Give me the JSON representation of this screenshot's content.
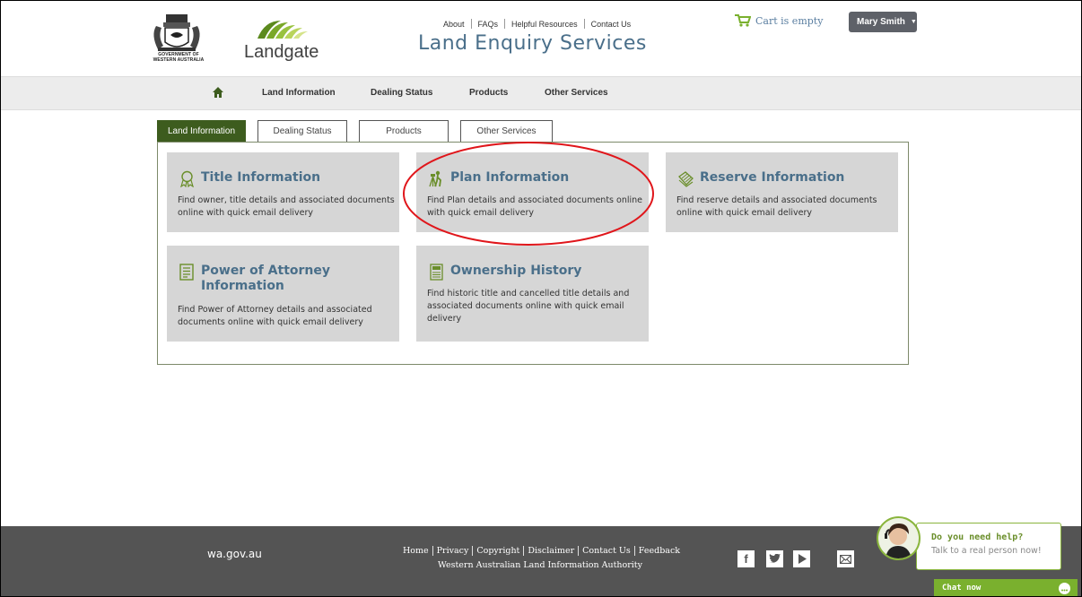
{
  "header": {
    "gov_logo_text": "GOVERNMENT OF\nWESTERN AUSTRALIA",
    "brand_name": "Landgate",
    "top_links": [
      "About",
      "FAQs",
      "Helpful Resources",
      "Contact Us"
    ],
    "site_title": "Land Enquiry Services",
    "cart_text": "Cart is empty",
    "user_name": "Mary Smith"
  },
  "navbar": {
    "home_icon": "home-icon",
    "items": [
      "Land Information",
      "Dealing Status",
      "Products",
      "Other Services"
    ]
  },
  "tabs": [
    "Land Information",
    "Dealing Status",
    "Products",
    "Other Services"
  ],
  "active_tab": "Land Information",
  "cards": [
    {
      "title": "Title Information",
      "icon": "ribbon-icon",
      "description": [
        "Find owner, title details and associated documents",
        "online with quick email delivery"
      ]
    },
    {
      "title": "Plan Information",
      "icon": "surveyor-icon",
      "description": [
        "Find Plan details and associated documents online",
        "with quick email delivery"
      ]
    },
    {
      "title": "Reserve Information",
      "icon": "map-icon",
      "description": [
        "Find reserve details and associated documents",
        "online with quick email delivery"
      ]
    },
    {
      "title_lines": [
        "Power of Attorney",
        "Information"
      ],
      "icon": "document-list-icon",
      "description": [
        "Find Power of Attorney details and associated",
        "documents online with quick email delivery"
      ]
    },
    {
      "title": "Ownership History",
      "icon": "archive-icon",
      "description": [
        "Find historic title and cancelled title details and",
        "associated documents online with quick email",
        "delivery"
      ]
    }
  ],
  "footer": {
    "wa_gov": "wa.gov.au",
    "links": [
      "Home",
      "Privacy",
      "Copyright",
      "Disclaimer",
      "Contact Us",
      "Feedback"
    ],
    "authority": "Western Australian Land Information Authority",
    "social": [
      "facebook-icon",
      "twitter-icon",
      "youtube-icon",
      "email-icon"
    ]
  },
  "chat": {
    "title": "Do you need help?",
    "subtitle": "Talk to a real person now!",
    "bar_label": "Chat now"
  },
  "colors": {
    "accent_green": "#3d5c1e",
    "title_blue": "#4a6f8a",
    "annotation_red": "#e0161b",
    "footer_bg": "#545454",
    "chat_green": "#7ab02e"
  }
}
